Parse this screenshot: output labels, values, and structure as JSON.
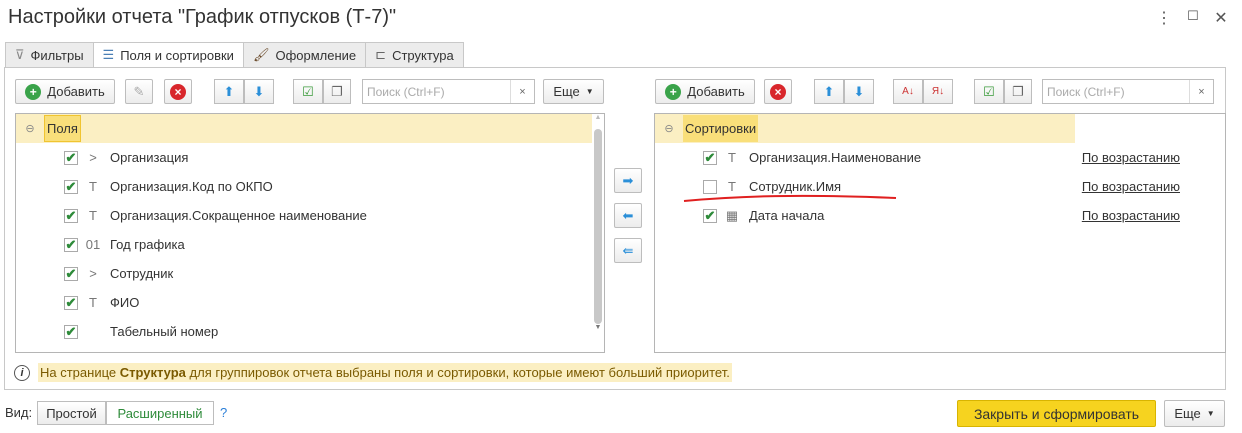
{
  "window": {
    "title": "Настройки отчета \"График отпусков (Т-7)\"",
    "menu_icon": "⋮",
    "max_icon": "☐",
    "close_icon": "✕"
  },
  "tabs": [
    {
      "label": "Фильтры"
    },
    {
      "label": "Поля и сортировки"
    },
    {
      "label": "Оформление"
    },
    {
      "label": "Структура"
    }
  ],
  "left": {
    "add": "Добавить",
    "search_placeholder": "Поиск (Ctrl+F)",
    "clear": "×",
    "more": "Еще",
    "root": "Поля",
    "items": [
      {
        "label": "Организация",
        "checked": true,
        "type": ">"
      },
      {
        "label": "Организация.Код по ОКПО",
        "checked": true,
        "type": "T"
      },
      {
        "label": "Организация.Сокращенное наименование",
        "checked": true,
        "type": "T"
      },
      {
        "label": "Год графика",
        "checked": true,
        "type": "01"
      },
      {
        "label": "Сотрудник",
        "checked": true,
        "type": ">"
      },
      {
        "label": "ФИО",
        "checked": true,
        "type": "T"
      },
      {
        "label": "Табельный номер",
        "checked": true,
        "type": ""
      }
    ]
  },
  "right": {
    "add": "Добавить",
    "search_placeholder": "Поиск (Ctrl+F)",
    "clear": "×",
    "root": "Сортировки",
    "items": [
      {
        "label": "Организация.Наименование",
        "checked": true,
        "type": "T",
        "order": "По возрастанию"
      },
      {
        "label": "Сотрудник.Имя",
        "checked": false,
        "type": "T",
        "order": "По возрастанию"
      },
      {
        "label": "Дата начала",
        "checked": true,
        "type": "cal",
        "order": "По возрастанию"
      }
    ]
  },
  "info": {
    "pre": "На странице ",
    "bold": "Структура",
    "post": " для группировок отчета выбраны поля и сортировки, которые имеют больший приоритет."
  },
  "footer": {
    "view_label": "Вид:",
    "simple": "Простой",
    "extended": "Расширенный",
    "help": "?",
    "submit": "Закрыть и сформировать",
    "more": "Еще"
  },
  "colors": {
    "accent": "#f6d31f",
    "highlight": "#fbefc3",
    "check": "#2e8b3a",
    "annotation": "#e02020"
  }
}
